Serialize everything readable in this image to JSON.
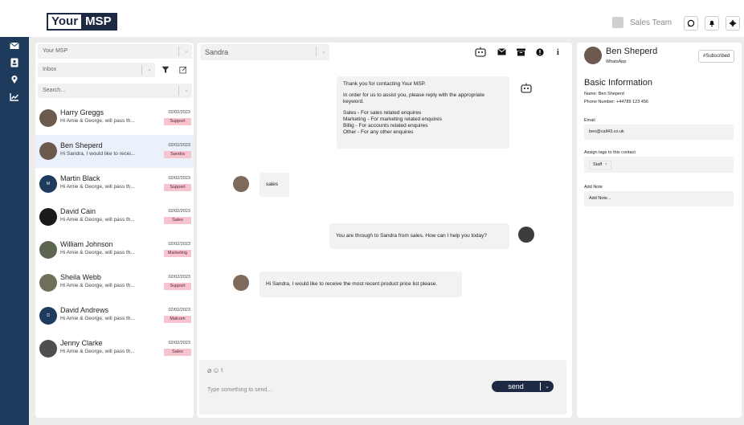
{
  "header": {
    "logo_part1": "Your",
    "logo_part2": "MSP",
    "team_label": "Sales Team",
    "icons": [
      "whatsapp-icon",
      "bell-icon",
      "gear-icon"
    ]
  },
  "rail": {
    "icons": [
      "mail-icon",
      "contacts-icon",
      "location-icon",
      "chart-icon"
    ]
  },
  "left": {
    "workspace_select": "Your MSP",
    "inbox_select": "Inbox",
    "search_placeholder": "Search...",
    "contacts": [
      {
        "name": "Harry Greggs",
        "preview": "Hi Amie & George, will pass th...",
        "date": "02/02/2023",
        "tag": "Support"
      },
      {
        "name": "Ben Sheperd",
        "preview": "Hi Sandra, I would like to recei...",
        "date": "02/02/2023",
        "tag": "Sandra"
      },
      {
        "name": "Martin Black",
        "preview": "Hi Amie & George, will pass th...",
        "date": "02/02/2023",
        "tag": "Support",
        "initial": "M"
      },
      {
        "name": "David Cain",
        "preview": "Hi Amie & George, will pass th...",
        "date": "02/02/2023",
        "tag": "Sales"
      },
      {
        "name": "William Johnson",
        "preview": "Hi Amie & George, will pass th...",
        "date": "02/02/2023",
        "tag": "Marketing"
      },
      {
        "name": "Sheila Webb",
        "preview": "Hi Amie & George, will pass th...",
        "date": "02/02/2023",
        "tag": "Support"
      },
      {
        "name": "David Andrews",
        "preview": "Hi Amie & George, will pass th...",
        "date": "02/02/2023",
        "tag": "Malcom",
        "initial": "D"
      },
      {
        "name": "Jenny Clarke",
        "preview": "Hi Amie & George, will pass th...",
        "date": "02/02/2023",
        "tag": "Sales"
      }
    ]
  },
  "chat": {
    "agent_select": "Sandra",
    "header_icons": [
      "robot-icon",
      "mail-icon",
      "archive-icon",
      "alert-icon",
      "info-icon"
    ],
    "messages": [
      {
        "line1": "Thank you for contacting Your MSP.",
        "line2": "In order for us to assist you, please reply with the appropriate keyword.",
        "opts": [
          "Sales - For sales related enquires",
          "Marketing - For marketing related enquires",
          "Billig - For accounts related enquires",
          "Other - For any other enquires"
        ]
      },
      {
        "text": "sales"
      },
      {
        "text": "You are through to Sandra from sales. How can I help you today?"
      },
      {
        "text": "Hi Sandra, I would like to receive the most recent product price list please."
      }
    ],
    "composer_placeholder": "Type something to send...",
    "send_label": "send"
  },
  "profile": {
    "name": "Ben Sheperd",
    "channel": "WhatsApp",
    "badge": "#Subscribed",
    "section_title": "Basic Information",
    "name_line": "Name: Ben Sheperd",
    "phone_line": "Phone Number: +44789 123 456",
    "email_label": "Email",
    "email_value": "ben@call43.co.uk",
    "tags_label": "Assign tags to this contact",
    "tag_value": "Staff",
    "note_label": "Add Note",
    "note_placeholder": "Add Note..."
  }
}
